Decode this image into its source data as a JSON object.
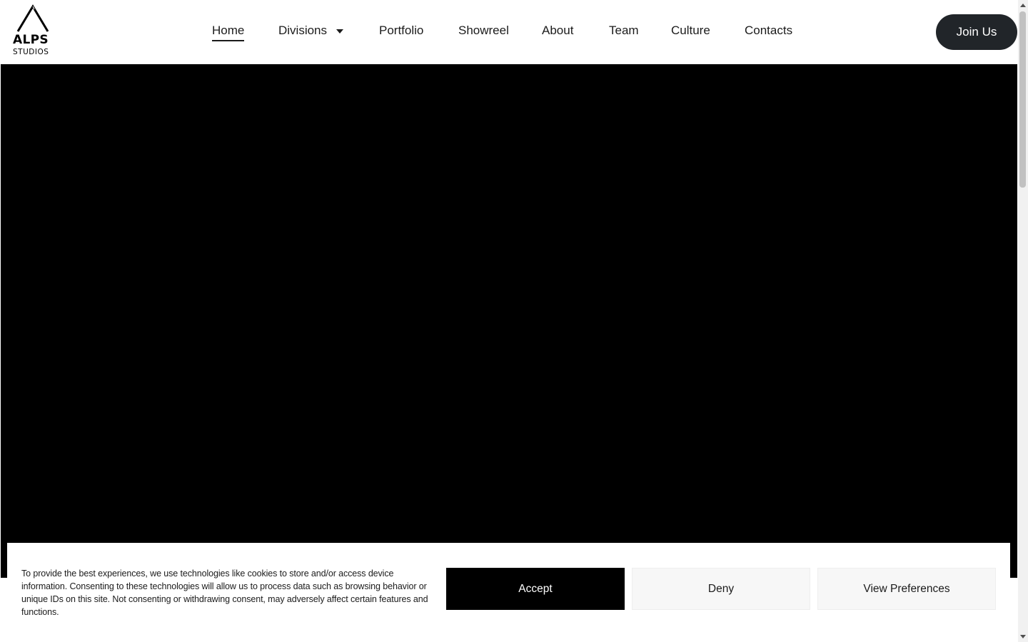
{
  "header": {
    "logo": {
      "name": "ALPS",
      "tagline": "STUDIOS"
    },
    "nav": [
      {
        "label": "Home",
        "active": true
      },
      {
        "label": "Divisions",
        "has_dropdown": true
      },
      {
        "label": "Portfolio"
      },
      {
        "label": "Showreel"
      },
      {
        "label": "About"
      },
      {
        "label": "Team"
      },
      {
        "label": "Culture"
      },
      {
        "label": "Contacts"
      }
    ],
    "cta_label": "Join Us"
  },
  "cookie_banner": {
    "message": "To provide the best experiences, we use technologies like cookies to store and/or access device information. Consenting to these technologies will allow us to process data such as browsing behavior or unique IDs on this site. Not consenting or withdrawing consent, may adversely affect certain features and functions.",
    "accept_label": "Accept",
    "deny_label": "Deny",
    "preferences_label": "View Preferences"
  },
  "colors": {
    "cta_background": "#212529",
    "hero_background": "#000000",
    "accept_background": "#000000",
    "secondary_button_background": "#f7f7f7"
  }
}
